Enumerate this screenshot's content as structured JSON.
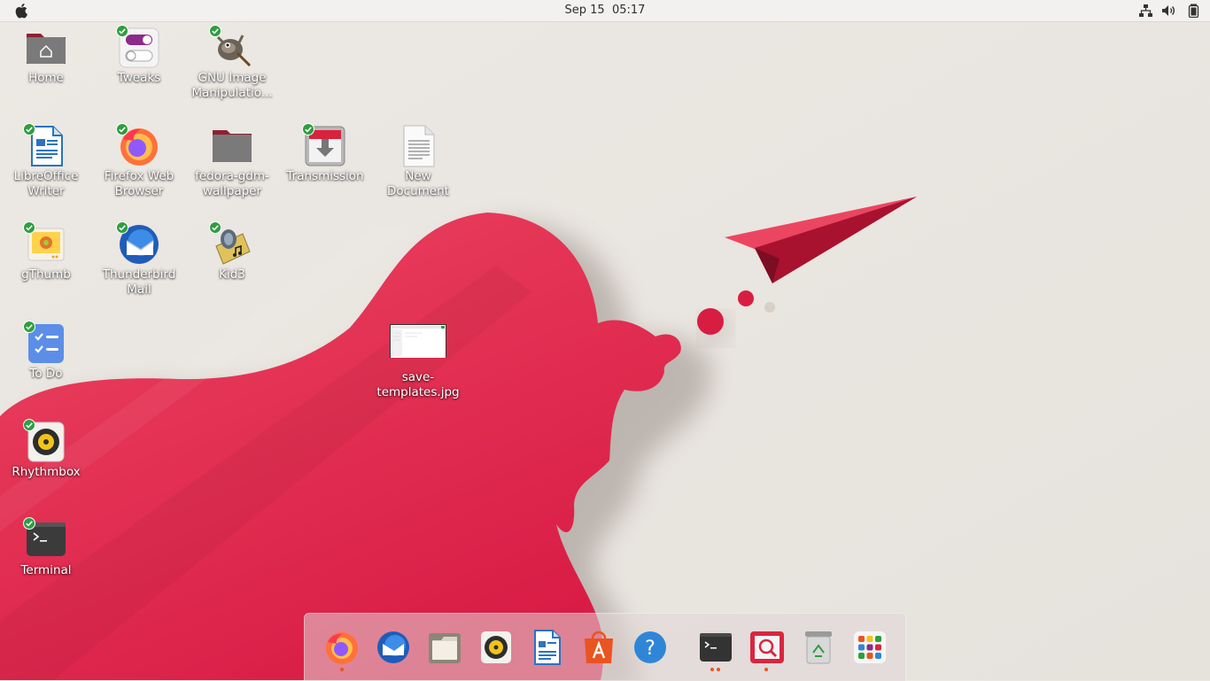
{
  "topbar": {
    "apple_icon": "apple-logo-icon",
    "date": "Sep 15",
    "time": "05:17",
    "tray_icons": [
      "network-icon",
      "volume-icon",
      "battery-icon"
    ]
  },
  "desktop": {
    "icons": [
      {
        "label": "Home",
        "icon": "home-folder-icon",
        "badge": false
      },
      {
        "label": "Tweaks",
        "icon": "tweaks-icon",
        "badge": true
      },
      {
        "label": "GNU Image Manipulatio...",
        "icon": "gimp-icon",
        "badge": true
      },
      {
        "label": "LibreOffice Writer",
        "icon": "libreoffice-writer-icon",
        "badge": true
      },
      {
        "label": "Firefox Web Browser",
        "icon": "firefox-icon",
        "badge": true
      },
      {
        "label": "fedora-gdm-wallpaper",
        "icon": "folder-icon",
        "badge": false
      },
      {
        "label": "Transmission",
        "icon": "transmission-icon",
        "badge": true
      },
      {
        "label": "New Document",
        "icon": "text-document-icon",
        "badge": false
      },
      {
        "label": "gThumb",
        "icon": "gthumb-icon",
        "badge": true
      },
      {
        "label": "Thunderbird Mail",
        "icon": "thunderbird-icon",
        "badge": true
      },
      {
        "label": "Kid3",
        "icon": "kid3-icon",
        "badge": true
      },
      {
        "label": "save-templates.jpg",
        "icon": "image-thumbnail-icon",
        "badge": false
      },
      {
        "label": "To Do",
        "icon": "todo-icon",
        "badge": true
      },
      {
        "label": "Rhythmbox",
        "icon": "rhythmbox-icon",
        "badge": true
      },
      {
        "label": "Terminal",
        "icon": "terminal-icon",
        "badge": true
      }
    ]
  },
  "dock": {
    "items": [
      {
        "icon": "firefox-icon",
        "running": true
      },
      {
        "icon": "thunderbird-icon",
        "running": false
      },
      {
        "icon": "files-icon",
        "running": false
      },
      {
        "icon": "rhythmbox-icon",
        "running": false
      },
      {
        "icon": "libreoffice-writer-icon",
        "running": false
      },
      {
        "icon": "software-center-icon",
        "running": false
      },
      {
        "icon": "help-icon",
        "running": false
      },
      {
        "icon": "terminal-icon",
        "running": true
      },
      {
        "icon": "screenshot-tool-icon",
        "running": true
      },
      {
        "icon": "trash-icon",
        "running": false
      },
      {
        "icon": "app-grid-icon",
        "running": false
      }
    ]
  },
  "colors": {
    "wallpaper_bg": "#ebe7e2",
    "wallpaper_accent": "#e0324f",
    "running_indicator": "#e95420"
  }
}
